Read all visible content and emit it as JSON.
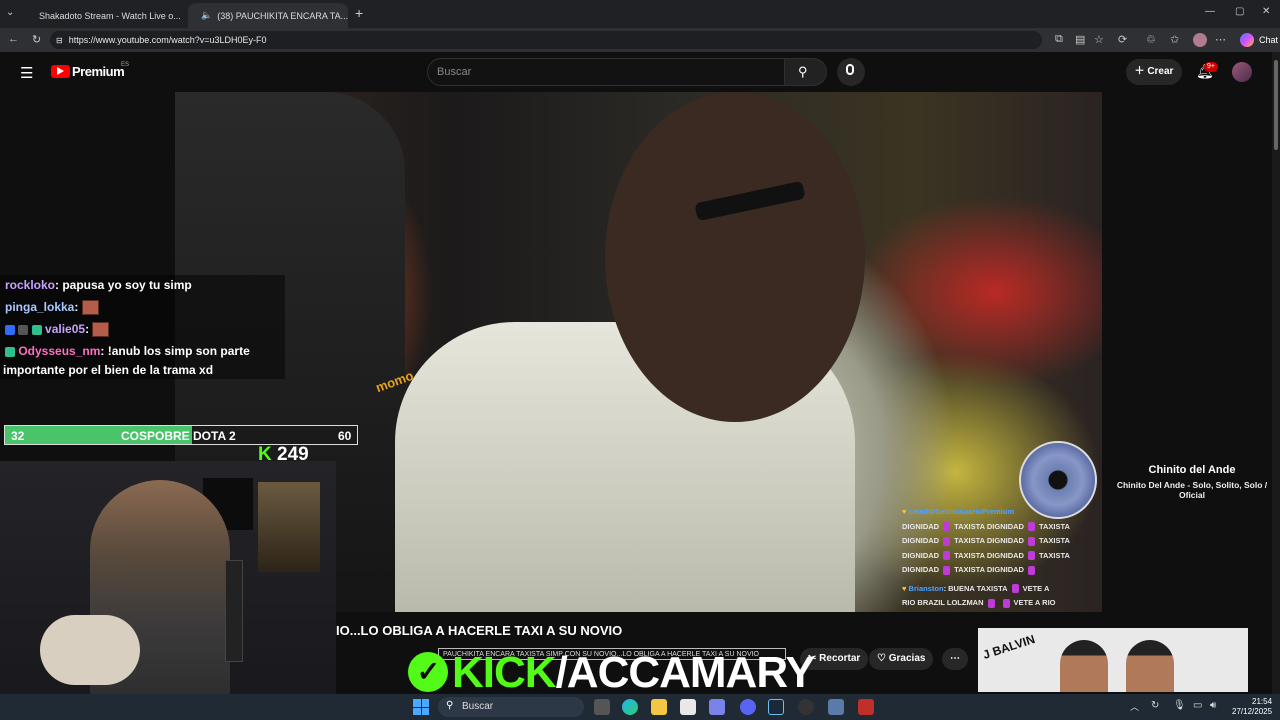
{
  "browser": {
    "tabs": [
      {
        "label": "Shakadoto Stream - Watch Live o..."
      },
      {
        "label": "(38) PAUCHIKITA ENCARA TA..."
      }
    ],
    "url": "https://www.youtube.com/watch?v=u3LDH0Ey-F0",
    "chat_label": "Chat"
  },
  "youtube": {
    "logo": "Premium",
    "region": "ES",
    "search_placeholder": "Buscar",
    "create_label": "Crear",
    "notif_count": "9+"
  },
  "stream_chat": [
    {
      "user": "rockloko",
      "text": ": papusa yo soy tu simp"
    },
    {
      "user": "pinga_lokka",
      "text": ":"
    },
    {
      "user": "valie05",
      "text": ":"
    },
    {
      "user": "Odysseus_nm",
      "text": ": !anub los simp son parte",
      "cont": "importante por el bien de la trama xd"
    }
  ],
  "poll": {
    "left_count": "32",
    "label": "COSPOBRE DOTA 2",
    "right_count": "60",
    "fill": 0.53
  },
  "kick_count": "249",
  "video_overlay_chat": {
    "user1": "catad0rDeG5usuarioPremium",
    "lines": [
      [
        "DIGNIDAD",
        "TAXISTA DIGNIDAD",
        "TAXISTA"
      ],
      [
        "DIGNIDAD",
        "TAXISTA DIGNIDAD",
        "TAXISTA"
      ],
      [
        "DIGNIDAD",
        "TAXISTA DIGNIDAD",
        "TAXISTA"
      ],
      [
        "DIGNIDAD",
        "TAXISTA DIGNIDAD",
        ""
      ]
    ],
    "user2": "Brianston",
    "msg2": ": BUENA TAXISTA",
    "msg2b": "VETE A",
    "msg3": "RIO BRAZIL LOLZMAN",
    "msg3b": "VETE A RIO"
  },
  "video": {
    "momo_text": "momo"
  },
  "video_title": "IO...LO OBLIGA A HACERLE TAXI A SU NOVIO",
  "channel_strip": "PAUCHIKITA ENCARA TAXISTA SIMP CON SU NOVIO...LO OBLIGA A HACERLE TAXI A SU NOVIO",
  "kick_banner": {
    "brand": "KICK",
    "handle": "/ACCAMARY"
  },
  "actions": {
    "clip": "Recortar",
    "thanks": "Gracias"
  },
  "now_playing": {
    "title": "Chinito del Ande",
    "subtitle": "Chinito Del Ande - Solo, Solito, Solo / Oficial"
  },
  "thumbnail_text": "J BALVIN",
  "taskbar": {
    "search": "Buscar",
    "time": "21:54",
    "date": "27/12/2025"
  }
}
